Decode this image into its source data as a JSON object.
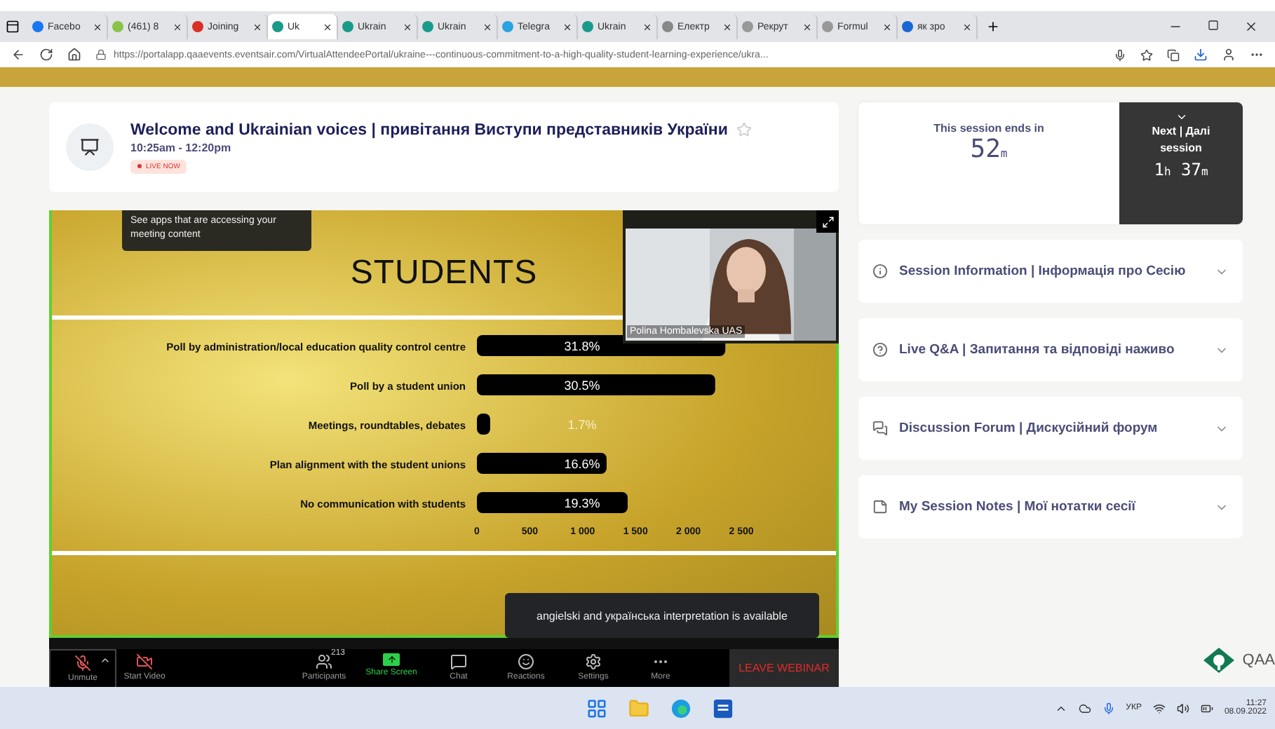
{
  "browser": {
    "tabs": [
      {
        "label": "Facebo",
        "selected": false
      },
      {
        "label": "(461) 8",
        "selected": false
      },
      {
        "label": "Joining",
        "selected": false
      },
      {
        "label": "Uk",
        "selected": true
      },
      {
        "label": "Ukrain",
        "selected": false
      },
      {
        "label": "Ukrain",
        "selected": false
      },
      {
        "label": "Telegra",
        "selected": false
      },
      {
        "label": "Ukrain",
        "selected": false
      },
      {
        "label": "Електр",
        "selected": false
      },
      {
        "label": "Рекрут",
        "selected": false
      },
      {
        "label": "Formul",
        "selected": false
      },
      {
        "label": "як зро",
        "selected": false
      }
    ],
    "address": "https://portalapp.qaaevents.eventsair.com/VirtualAttendeePortal/ukraine---continuous-commitment-to-a-high-quality-student-learning-experience/ukra..."
  },
  "session": {
    "title": "Welcome and Ukrainian voices | привітання Виступи представників України",
    "time": "10:25am - 12:20pm",
    "badge": "LIVE NOW"
  },
  "slide": {
    "tooltip": "See apps that are accessing your meeting content",
    "chart_data": {
      "type": "bar",
      "orientation": "horizontal",
      "title": "STUDENTS",
      "categories": [
        "Poll by administration/local education quality control centre",
        "Poll by a student union",
        "Meetings, roundtables, debates",
        "Plan alignment with the student unions",
        "No communication with students"
      ],
      "values": [
        31.8,
        30.5,
        1.7,
        16.6,
        19.3
      ],
      "value_labels": [
        "31.8%",
        "30.5%",
        "1.7%",
        "16.6%",
        "19.3%"
      ]
    },
    "axis_labels": [
      "0",
      "500",
      "1 000",
      "1 500",
      "2 000",
      "2 500"
    ],
    "speaker": "Polina Hombalevska UAS",
    "interpretation": "angielski and українська interpretation is available"
  },
  "meeting_toolbar": {
    "items": [
      {
        "kind": "unmute",
        "label": "Unmute"
      },
      {
        "kind": "video",
        "label": "Start Video"
      },
      {
        "kind": "participants",
        "label": "Participants",
        "count": "213"
      },
      {
        "kind": "share",
        "label": "Share Screen"
      },
      {
        "kind": "chat",
        "label": "Chat"
      },
      {
        "kind": "reactions",
        "label": "Reactions"
      },
      {
        "kind": "settings",
        "label": "Settings"
      },
      {
        "kind": "more",
        "label": "More"
      }
    ],
    "leave": "LEAVE WEBINAR"
  },
  "timer": {
    "label": "This session ends in",
    "value": "52",
    "unit": "m",
    "next": {
      "label": "Next | Далі session",
      "parts": [
        {
          "value": "1",
          "unit": "h"
        },
        {
          "value": "37",
          "unit": "m"
        }
      ]
    }
  },
  "panels": [
    {
      "kind": "info",
      "label": "Session Information | Інформація про Сесію",
      "expanded": false
    },
    {
      "kind": "question",
      "label": "Live Q&A | Запитання та відповіді наживо",
      "expanded": false
    },
    {
      "kind": "forum",
      "label": "Discussion Forum | Дискусійний форум",
      "expanded": false
    },
    {
      "kind": "notes",
      "label": "My Session Notes | Мої нотатки сесії",
      "expanded": false
    }
  ],
  "logo": "QAA",
  "taskbar": {
    "language": "УКР",
    "time": "11:27",
    "date": "08.09.2022"
  }
}
